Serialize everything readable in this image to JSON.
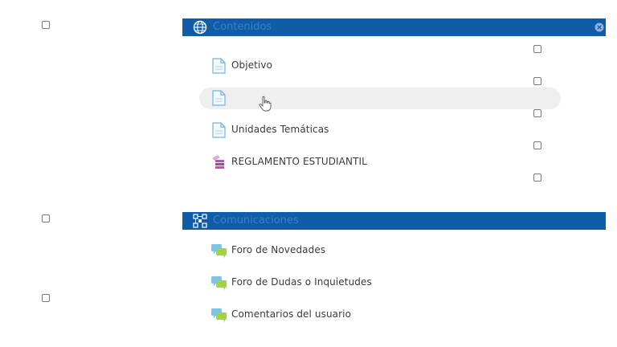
{
  "sections": [
    {
      "title": "Contenidos",
      "icon": "globe-icon",
      "items": [
        {
          "label": "Objetivo",
          "icon": "page-icon"
        },
        {
          "label": "",
          "icon": "page-icon"
        },
        {
          "label": "Unidades Temáticas",
          "icon": "page-icon"
        },
        {
          "label": "REGLAMENTO ESTUDIANTIL",
          "icon": "book-icon"
        }
      ]
    },
    {
      "title": "Comunicaciones",
      "icon": "network-icon",
      "items": [
        {
          "label": "Foro de Novedades",
          "icon": "forum-icon"
        },
        {
          "label": "Foro de Dudas o Inquietudes",
          "icon": "forum-icon"
        },
        {
          "label": "Comentarios del usuario",
          "icon": "forum-icon"
        }
      ]
    }
  ],
  "colors": {
    "header_bg": "#0f5da8",
    "header_text": "#3c7fc4",
    "hover_bg": "#efefef"
  }
}
